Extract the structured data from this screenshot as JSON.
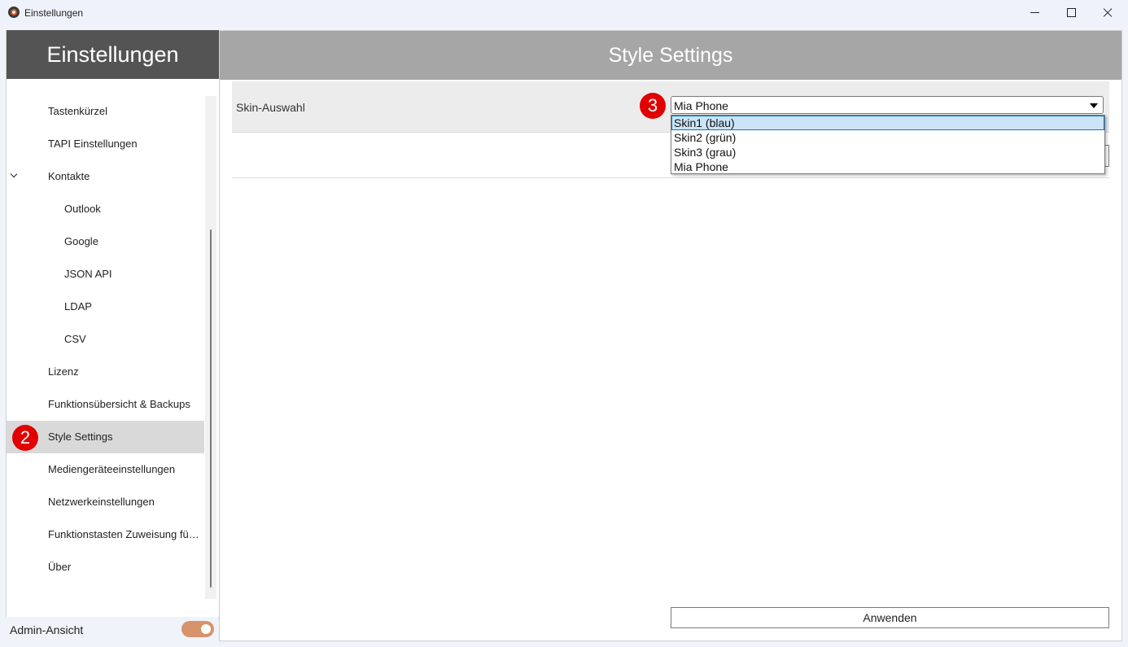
{
  "window": {
    "title": "Einstellungen"
  },
  "sidebar": {
    "header": "Einstellungen",
    "items": [
      {
        "label": "Tastenkürzel",
        "level": 1
      },
      {
        "label": "TAPI Einstellungen",
        "level": 1
      },
      {
        "label": "Kontakte",
        "level": 1,
        "expanded": true
      },
      {
        "label": "Outlook",
        "level": 2
      },
      {
        "label": "Google",
        "level": 2
      },
      {
        "label": "JSON API",
        "level": 2
      },
      {
        "label": "LDAP",
        "level": 2
      },
      {
        "label": "CSV",
        "level": 2
      },
      {
        "label": "Lizenz",
        "level": 1
      },
      {
        "label": "Funktionsübersicht & Backups",
        "level": 1
      },
      {
        "label": "Style Settings",
        "level": 1,
        "selected": true
      },
      {
        "label": "Mediengeräteeinstellungen",
        "level": 1
      },
      {
        "label": "Netzwerkeinstellungen",
        "level": 1
      },
      {
        "label": "Funktionstasten Zuweisung fü…",
        "level": 1
      },
      {
        "label": "Über",
        "level": 1
      }
    ],
    "footer": {
      "admin_label": "Admin-Ansicht",
      "admin_toggle_on": true
    }
  },
  "main": {
    "title": "Style Settings",
    "skin": {
      "label": "Skin-Auswahl",
      "selected": "Mia Phone",
      "options": [
        "Skin1 (blau)",
        "Skin2 (grün)",
        "Skin3 (grau)",
        "Mia Phone"
      ],
      "highlighted_option": "Skin1 (blau)"
    },
    "apply_label": "Anwenden"
  },
  "annotations": {
    "badge_sidebar": "2",
    "badge_dropdown": "3"
  },
  "colors": {
    "sidebar_header": "#545454",
    "main_header": "#a6a6a6",
    "selected_item": "#d9d9d9",
    "toggle": "#d7936a",
    "badge": "#e00000",
    "dropdown_highlight": "#cce4f7"
  },
  "icons": {
    "app": "app-logo-icon",
    "minimize": "minimize-icon",
    "maximize": "maximize-icon",
    "close": "close-icon",
    "expand": "chevron-down-icon",
    "dropdown": "dropdown-arrow-icon"
  }
}
